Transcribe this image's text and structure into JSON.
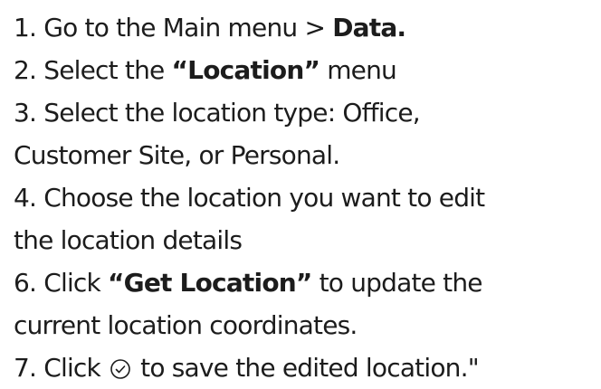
{
  "steps": {
    "step1": {
      "prefix": "1. Go to the Main menu > ",
      "bold": "Data."
    },
    "step2": {
      "prefix": "2. Select the ",
      "open_quote": "“",
      "bold": "Location",
      "close_quote": "”",
      "suffix": " menu"
    },
    "step3": {
      "line1": "3. Select the location type: Office,",
      "line2": "Customer Site, or Personal."
    },
    "step4": {
      "line1": "4. Choose the location you want to edit",
      "line2": "the location details"
    },
    "step6": {
      "prefix": "6. Click ",
      "open_quote": "“",
      "bold": "Get Location",
      "close_quote": "”",
      "suffix": " to update the",
      "line2": "current location coordinates."
    },
    "step7": {
      "prefix": "7. Click ",
      "icon": "check-circle-icon",
      "suffix": " to save the edited location.\""
    }
  },
  "colors": {
    "text": "#1c1c1c",
    "background": "#ffffff"
  }
}
